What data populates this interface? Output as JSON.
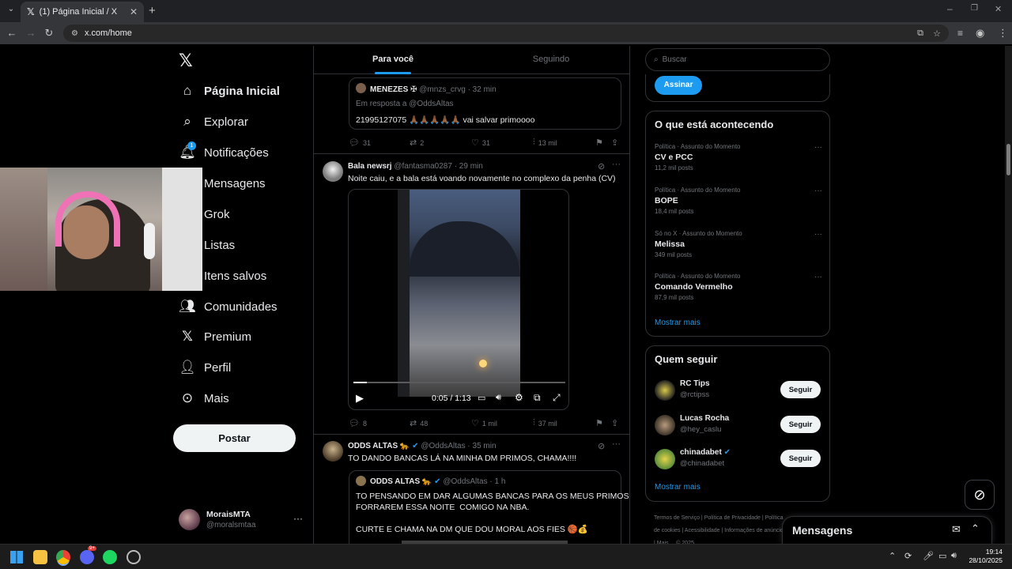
{
  "browser": {
    "tab_title": "(1) Página Inicial / X",
    "url": "x.com/home"
  },
  "nav": {
    "items": [
      {
        "label": "Página Inicial",
        "icon": "home-icon"
      },
      {
        "label": "Explorar",
        "icon": "search-icon"
      },
      {
        "label": "Notificações",
        "icon": "bell-icon",
        "badge": "1"
      },
      {
        "label": "Mensagens",
        "icon": "mail-icon"
      },
      {
        "label": "Grok",
        "icon": "grok-icon"
      },
      {
        "label": "Listas",
        "icon": "list-icon"
      },
      {
        "label": "Itens salvos",
        "icon": "bookmark-icon"
      },
      {
        "label": "Comunidades",
        "icon": "communities-icon"
      },
      {
        "label": "Premium",
        "icon": "x-logo-icon"
      },
      {
        "label": "Perfil",
        "icon": "person-icon"
      },
      {
        "label": "Mais",
        "icon": "more-circle-icon"
      }
    ],
    "post_label": "Postar"
  },
  "account": {
    "name": "MoraisMTA",
    "handle": "@moralsmtaa"
  },
  "feed": {
    "tabs": [
      "Para você",
      "Seguindo"
    ],
    "tweet1": {
      "author": "MENEZES ✠",
      "handle": "@mnzs_crvg",
      "time": "· 32 min",
      "reply_to": "Em resposta a @OddsAltas",
      "text": "21995127075 🙏🏾🙏🏾🙏🏾🙏🏾🙏🏾 vai salvar primoooo",
      "replies": "31",
      "reposts": "2",
      "likes": "31",
      "views": "13 mil"
    },
    "tweet2": {
      "author": "Bala newsrj",
      "handle": "@fantasma0287",
      "time": "· 29 min",
      "text": "Noite caiu, e a bala está voando novamente no complexo da penha (CV)",
      "video_time": "0:05 / 1:13",
      "video_progress": 0.064,
      "replies": "8",
      "reposts": "48",
      "likes": "1 mil",
      "views": "37 mil"
    },
    "tweet3": {
      "author": "ODDS ALTAS 🐆",
      "handle": "@OddsAltas",
      "time": "· 35 min",
      "text": "TO DANDO BANCAS LÁ NA MINHA DM PRIMOS, CHAMA!!!!",
      "quote": {
        "author": "ODDS ALTAS 🐆",
        "handle": "@OddsAltas",
        "time": "· 1 h",
        "line1": "TO PENSANDO EM DAR ALGUMAS BANCAS PARA OS MEUS PRIMOS",
        "line2": "FORRAREM ESSA NOITE  COMIGO NA NBA.",
        "line3": "CURTE E CHAMA NA DM QUE DOU MORAL AOS FIES 🏀💰"
      }
    }
  },
  "sidebar": {
    "search_placeholder": "Buscar",
    "subscribe_label": "Assinar",
    "trends_title": "O que está acontecendo",
    "trends": [
      {
        "meta": "Política · Assunto do Momento",
        "name": "CV e PCC",
        "posts": "11,2 mil posts"
      },
      {
        "meta": "Política · Assunto do Momento",
        "name": "BOPE",
        "posts": "18,4 mil posts"
      },
      {
        "meta": "Só no X · Assunto do Momento",
        "name": "Melissa",
        "posts": "349 mil posts"
      },
      {
        "meta": "Política · Assunto do Momento",
        "name": "Comando Vermelho",
        "posts": "87,9 mil posts"
      }
    ],
    "show_more": "Mostrar mais",
    "who_title": "Quem seguir",
    "who": [
      {
        "name": "RC Tips",
        "handle": "@rctipss",
        "verified": false
      },
      {
        "name": "Lucas Rocha",
        "handle": "@hey_caslu",
        "verified": false
      },
      {
        "name": "chinadabet",
        "handle": "@chinadabet",
        "verified": true
      }
    ],
    "follow_label": "Seguir",
    "footer": [
      "Termos de Serviço",
      "Política de Privacidade",
      "Política de cookies",
      "Acessibilidade",
      "Informações de anúncios",
      "Mais ...",
      "© 2025"
    ]
  },
  "messages_drawer": {
    "title": "Mensagens"
  },
  "taskbar": {
    "time": "19:14",
    "date": "28/10/2025",
    "discord_badge": "9+"
  }
}
